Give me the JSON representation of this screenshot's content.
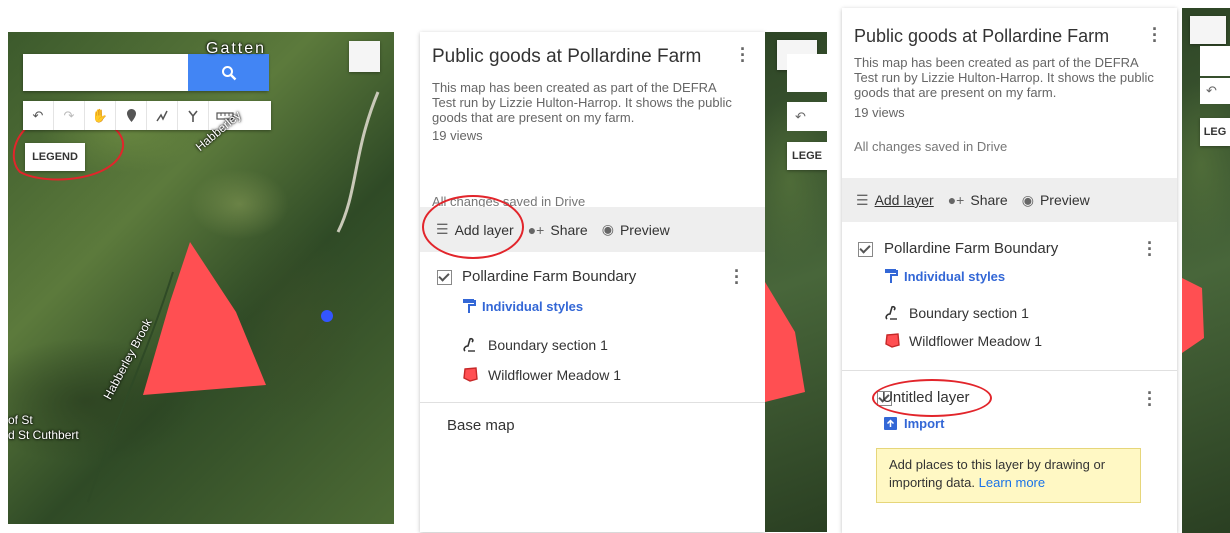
{
  "left_map": {
    "search": {
      "placeholder": ""
    },
    "search_icon": "magnifier-icon",
    "tools": [
      "undo-icon",
      "redo-icon",
      "hand-icon",
      "marker-icon",
      "draw-line-icon",
      "route-icon",
      "ruler-icon"
    ],
    "legend_label": "LEGEND",
    "labels": {
      "top_place": "Gatten",
      "road": "Habberley",
      "brook": "Habberley Brook",
      "church_line1": "of St",
      "church_line2": "d St Cuthbert"
    },
    "colors": {
      "polygon": "#ff4f52",
      "search_button": "#4285f4",
      "location_dot": "#3355ff",
      "annotation": "#e2252b"
    }
  },
  "center_panel": {
    "title": "Public goods at Pollardine Farm",
    "description": "This map has been created as part of the DEFRA Test run by Lizzie Hulton-Harrop. It shows the public goods that are present on my farm.",
    "views": "19 views",
    "saved_status": "All changes saved in Drive",
    "actions": {
      "add_layer": "Add layer",
      "share": "Share",
      "preview": "Preview"
    },
    "layer": {
      "name": "Pollardine Farm Boundary",
      "styles": "Individual styles",
      "features": [
        "Boundary section 1",
        "Wildflower Meadow 1"
      ]
    },
    "base_map": "Base map"
  },
  "center_map_edge": {
    "legend_label_partial": "LEGE"
  },
  "right_panel": {
    "title": "Public goods at Pollardine Farm",
    "description": "This map has been created as part of the DEFRA Test run by Lizzie Hulton-Harrop. It shows the public goods that are present on my farm.",
    "views": "19 views",
    "saved_status": "All changes saved in Drive",
    "actions": {
      "add_layer": "Add layer",
      "share": "Share",
      "preview": "Preview"
    },
    "layer1": {
      "name": "Pollardine Farm Boundary",
      "styles": "Individual styles",
      "features": [
        "Boundary section 1",
        "Wildflower Meadow 1"
      ]
    },
    "layer2": {
      "name": "Untitled layer",
      "import": "Import",
      "tooltip_text": "Add places to this layer by drawing or importing data.",
      "tooltip_link": "Learn more"
    }
  },
  "right_map_edge": {
    "legend_label_partial": "LEG"
  }
}
